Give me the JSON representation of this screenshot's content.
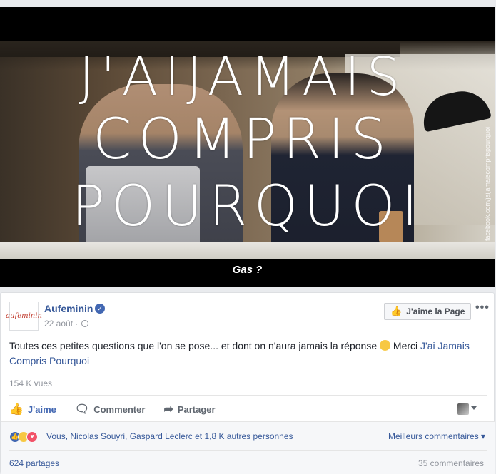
{
  "video": {
    "title_line1": "J'AIJAMAIS",
    "title_line2": "COMPRIS",
    "title_line3": "POURQUOI",
    "subtitle": "Gas ?",
    "side_watermark": "facebook.com/jaijamaiscomprispourquoi"
  },
  "post": {
    "page_name": "Aufeminin",
    "avatar_text": "aufeminin",
    "date": "22 août ·",
    "like_page_label": "J'aime la Page",
    "more_label": "•••",
    "text": "Toutes ces petites questions que l'on se pose... et dont on n'aura jamais la réponse",
    "text_after_emoji": " Merci ",
    "link_text": "J'ai Jamais Compris Pourquoi",
    "views": "154 K vues"
  },
  "actions": {
    "like": "J'aime",
    "comment": "Commenter",
    "share": "Partager"
  },
  "reactions": {
    "summary": "Vous, Nicolas Souyri, Gaspard Leclerc et 1,8 K autres personnes",
    "top_comments": "Meilleurs commentaires ▾",
    "shares": "624 partages",
    "comments": "35 commentaires"
  },
  "colors": {
    "link": "#365899",
    "like_blue": "#4267b2",
    "love": "#f25268",
    "haha": "#f7c843"
  }
}
